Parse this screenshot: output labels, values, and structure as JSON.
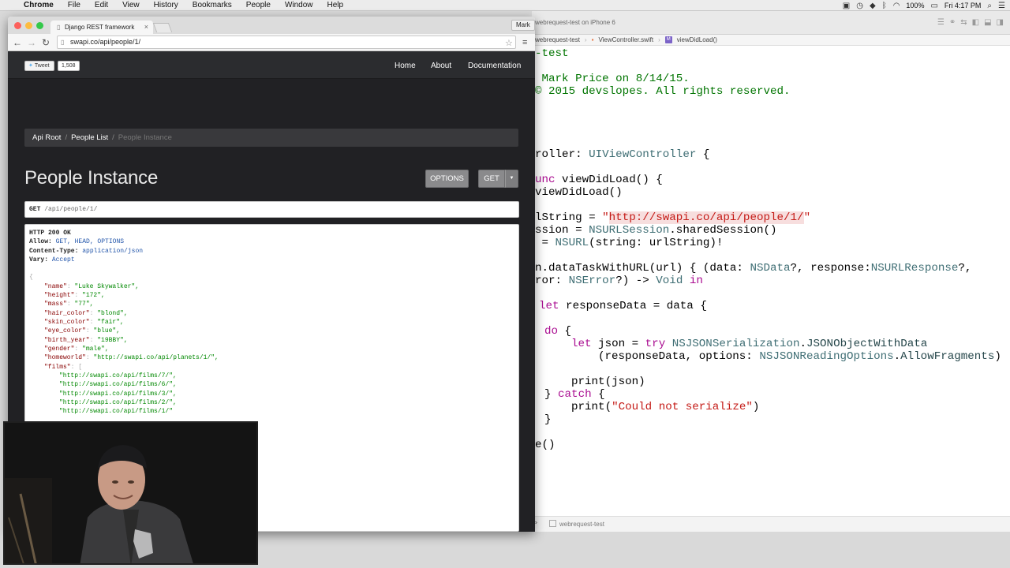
{
  "menubar": {
    "app": "Chrome",
    "items": [
      "File",
      "Edit",
      "View",
      "History",
      "Bookmarks",
      "People",
      "Window",
      "Help"
    ],
    "battery": "100%",
    "clock": "Fri 4:17 PM"
  },
  "browser": {
    "tab_title": "Django REST framework",
    "profile": "Mark",
    "url": "swapi.co/api/people/1/"
  },
  "site": {
    "tweet_label": "Tweet",
    "tweet_count": "1,508",
    "nav": [
      "Home",
      "About",
      "Documentation"
    ],
    "breadcrumb": [
      "Api Root",
      "People List",
      "People Instance"
    ],
    "title": "People Instance",
    "options_button": "OPTIONS",
    "get_button": "GET",
    "request_method": "GET",
    "request_path": "/api/people/1/",
    "response": {
      "status": "HTTP 200 OK",
      "allow_key": "Allow:",
      "allow_val": "GET, HEAD, OPTIONS",
      "ctype_key": "Content-Type:",
      "ctype_val": "application/json",
      "vary_key": "Vary:",
      "vary_val": "Accept",
      "open_brace": "{",
      "fields": [
        {
          "key": "\"name\"",
          "val": "\"Luke Skywalker\","
        },
        {
          "key": "\"height\"",
          "val": "\"172\","
        },
        {
          "key": "\"mass\"",
          "val": "\"77\","
        },
        {
          "key": "\"hair_color\"",
          "val": "\"blond\","
        },
        {
          "key": "\"skin_color\"",
          "val": "\"fair\","
        },
        {
          "key": "\"eye_color\"",
          "val": "\"blue\","
        },
        {
          "key": "\"birth_year\"",
          "val": "\"19BBY\","
        },
        {
          "key": "\"gender\"",
          "val": "\"male\","
        },
        {
          "key": "\"homeworld\"",
          "val": "\"http://swapi.co/api/planets/1/\","
        },
        {
          "key": "\"films\"",
          "val": "["
        }
      ],
      "films": [
        "\"http://swapi.co/api/films/7/\",",
        "\"http://swapi.co/api/films/6/\",",
        "\"http://swapi.co/api/films/3/\",",
        "\"http://swapi.co/api/films/2/\",",
        "\"http://swapi.co/api/films/1/\""
      ]
    }
  },
  "xcode": {
    "scheme": "webrequest-test on iPhone 6",
    "jumpbar": [
      "webrequest-test",
      "ViewController.swift",
      "viewDidLoad()"
    ],
    "status": "webrequest-test",
    "code": {
      "l1": "-test",
      "l2": " Mark Price on 8/14/15.",
      "l3": "© 2015 devslopes. All rights reserved.",
      "l4a": "roller: ",
      "l4b": "UIViewController",
      "l4c": " {",
      "l5a": "unc",
      "l5b": " viewDidLoad() {",
      "l6": "viewDidLoad()",
      "l7a": "lString = ",
      "l7b": "\"",
      "l7c": "http://swapi.co/api/people/1/",
      "l7d": "\"",
      "l8a": "ssion = ",
      "l8b": "NSURLSession",
      "l8c": ".sharedSession()",
      "l9a": " = ",
      "l9b": "NSURL",
      "l9c": "(string: urlString)!",
      "l10a": "n.dataTaskWithURL(url) { (data: ",
      "l10b": "NSData",
      "l10c": "?, response:",
      "l10d": "NSURLResponse",
      "l10e": "?,",
      "l11a": "ror: ",
      "l11b": "NSError",
      "l11c": "?) -> ",
      "l11d": "Void",
      "l11e": " in",
      "l12a": "let",
      "l12b": " responseData = data {",
      "l13a": "do",
      "l13b": " {",
      "l14a": "let",
      "l14b": " json = ",
      "l14c": "try",
      "l14d": " ",
      "l14e": "NSJSONSerialization",
      "l14f": ".",
      "l14g": "JSONObjectWithData",
      "l15a": "(responseData, options: ",
      "l15b": "NSJSONReadingOptions",
      "l15c": ".",
      "l15d": "AllowFragments",
      "l15e": ")",
      "l16": "print(json)",
      "l17a": "} ",
      "l17b": "catch",
      "l17c": " {",
      "l18a": "print(",
      "l18b": "\"Could not serialize\"",
      "l18c": ")",
      "l19": "}",
      "l20": "e()"
    }
  },
  "colors": {
    "page_bg": "#212124",
    "xcode_comment": "#007400",
    "xcode_keyword": "#aa0d91",
    "xcode_string": "#c41a16"
  }
}
